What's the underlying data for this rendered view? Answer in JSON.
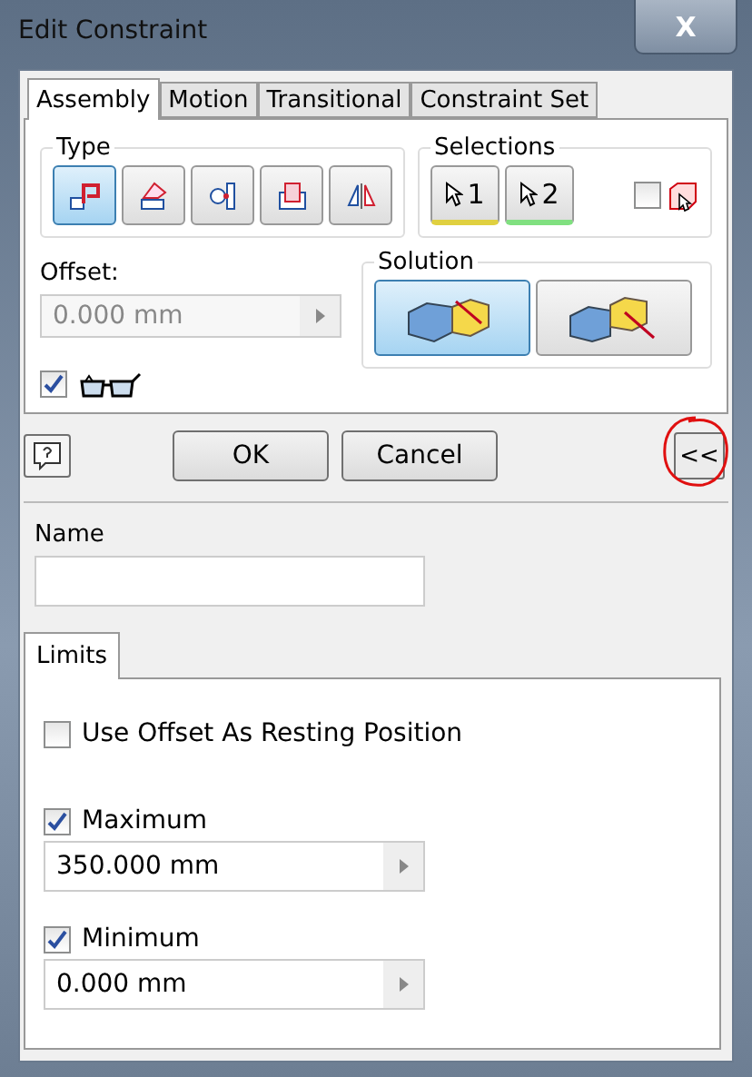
{
  "window": {
    "title": "Edit Constraint",
    "close_label": "X"
  },
  "tabs": [
    {
      "label": "Assembly",
      "selected": true
    },
    {
      "label": "Motion",
      "selected": false
    },
    {
      "label": "Transitional",
      "selected": false
    },
    {
      "label": "Constraint Set",
      "selected": false
    }
  ],
  "type_group": {
    "title": "Type",
    "buttons": [
      {
        "kind": "mate",
        "selected": true
      },
      {
        "kind": "angle",
        "selected": false
      },
      {
        "kind": "tangent",
        "selected": false
      },
      {
        "kind": "insert",
        "selected": false
      },
      {
        "kind": "symmetry",
        "selected": false
      }
    ]
  },
  "selections_group": {
    "title": "Selections",
    "buttons": [
      {
        "label": "1",
        "color": "#e0d040"
      },
      {
        "label": "2",
        "color": "#80e080"
      }
    ],
    "first_occurrence": {
      "checked": false
    }
  },
  "offset": {
    "label": "Offset:",
    "value": "0.000 mm",
    "disabled": true
  },
  "preview": {
    "checked": true
  },
  "solution_group": {
    "title": "Solution",
    "buttons": [
      {
        "kind": "mate",
        "selected": true
      },
      {
        "kind": "flush",
        "selected": false
      }
    ]
  },
  "buttons": [
    {
      "kind": "help"
    },
    {
      "kind": "text",
      "label": "OK"
    },
    {
      "kind": "text",
      "label": "Cancel"
    },
    {
      "kind": "expand",
      "label": "<<",
      "circled": true
    }
  ],
  "name": {
    "label": "Name"
  },
  "limits_tab": {
    "label": "Limits",
    "selected": true
  },
  "limits": [
    {
      "kind": "checkbox",
      "label": "Use Offset As Resting Position",
      "checked": false
    },
    {
      "kind": "value",
      "label": "Maximum",
      "checked": true,
      "value": "350.000 mm"
    },
    {
      "kind": "value",
      "label": "Minimum",
      "checked": true,
      "value": "0.000 mm"
    }
  ]
}
